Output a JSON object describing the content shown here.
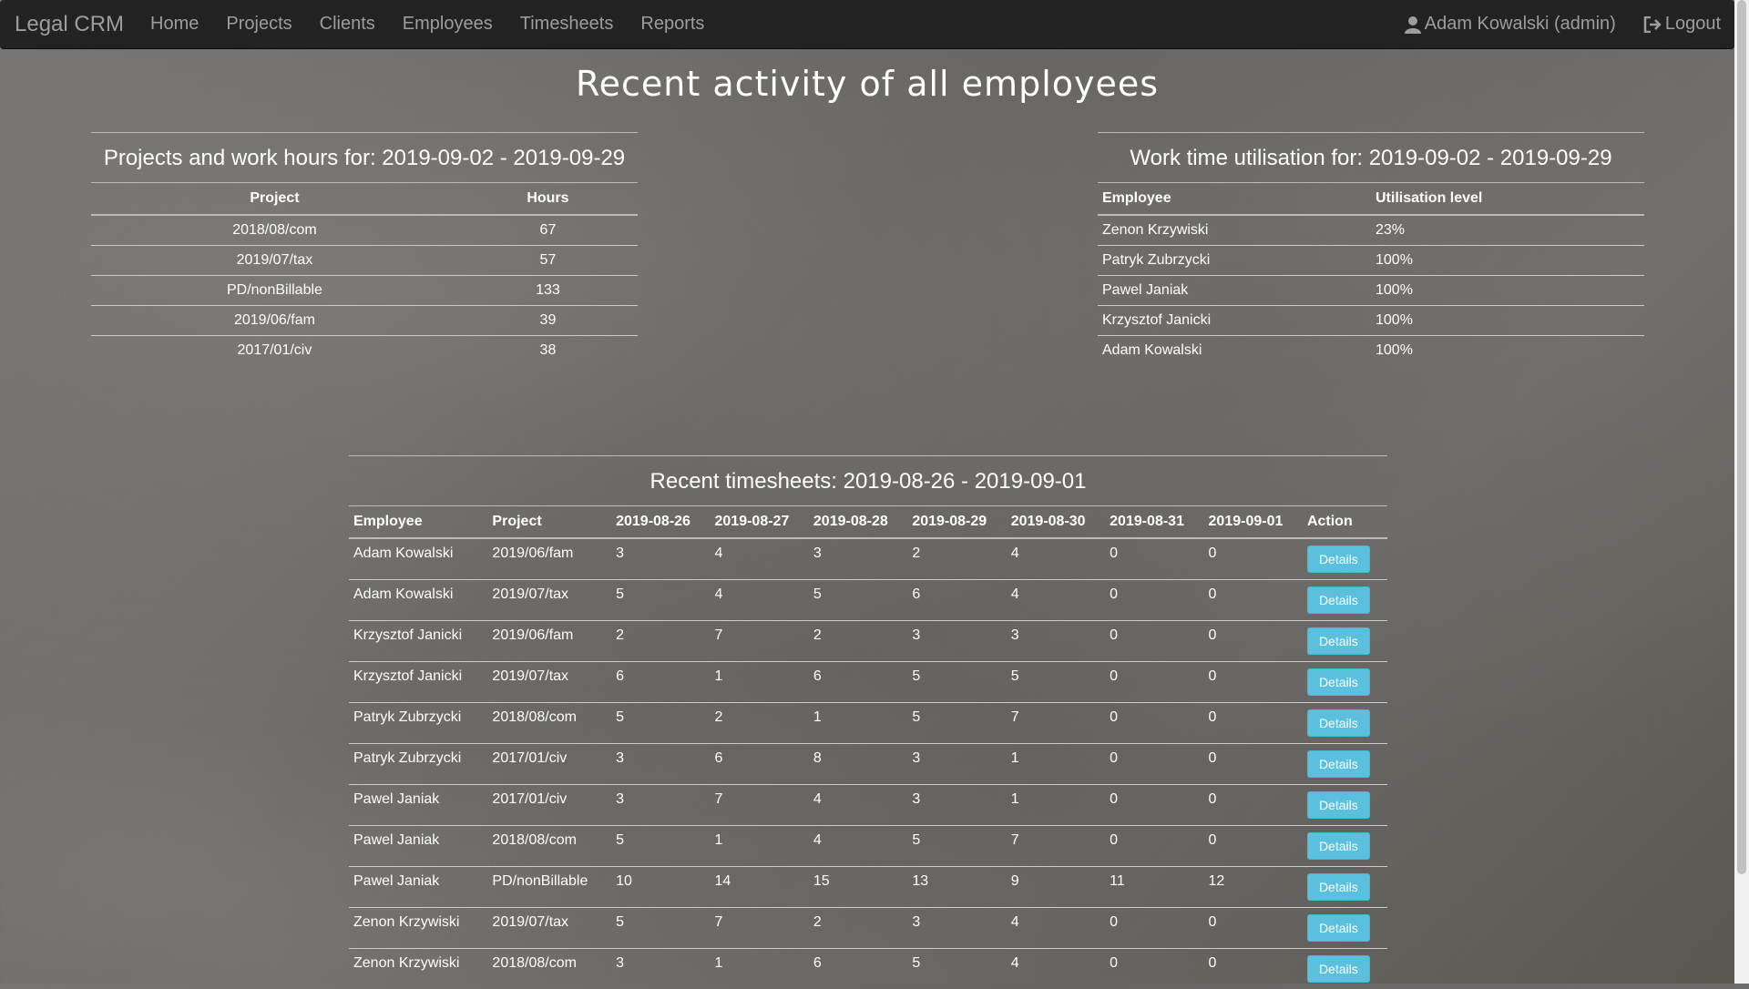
{
  "nav": {
    "brand": "Legal CRM",
    "links": [
      "Home",
      "Projects",
      "Clients",
      "Employees",
      "Timesheets",
      "Reports"
    ],
    "user": "Adam Kowalski (admin)",
    "logout": "Logout"
  },
  "page_title": "Recent activity of all employees",
  "projects": {
    "title": "Projects and work hours for: 2019-09-02 - 2019-09-29",
    "headers": [
      "Project",
      "Hours"
    ],
    "rows": [
      [
        "2018/08/com",
        "67"
      ],
      [
        "2019/07/tax",
        "57"
      ],
      [
        "PD/nonBillable",
        "133"
      ],
      [
        "2019/06/fam",
        "39"
      ],
      [
        "2017/01/civ",
        "38"
      ]
    ]
  },
  "utilisation": {
    "title": "Work time utilisation for: 2019-09-02 - 2019-09-29",
    "headers": [
      "Employee",
      "Utilisation level"
    ],
    "rows": [
      [
        "Zenon Krzywiski",
        "23%"
      ],
      [
        "Patryk Zubrzycki",
        "100%"
      ],
      [
        "Pawel Janiak",
        "100%"
      ],
      [
        "Krzysztof Janicki",
        "100%"
      ],
      [
        "Adam Kowalski",
        "100%"
      ]
    ]
  },
  "timesheets": {
    "title": "Recent timesheets: 2019-08-26 - 2019-09-01",
    "headers": [
      "Employee",
      "Project",
      "2019-08-26",
      "2019-08-27",
      "2019-08-28",
      "2019-08-29",
      "2019-08-30",
      "2019-08-31",
      "2019-09-01",
      "Action"
    ],
    "button_label": "Details",
    "rows": [
      [
        "Adam Kowalski",
        "2019/06/fam",
        "3",
        "4",
        "3",
        "2",
        "4",
        "0",
        "0"
      ],
      [
        "Adam Kowalski",
        "2019/07/tax",
        "5",
        "4",
        "5",
        "6",
        "4",
        "0",
        "0"
      ],
      [
        "Krzysztof Janicki",
        "2019/06/fam",
        "2",
        "7",
        "2",
        "3",
        "3",
        "0",
        "0"
      ],
      [
        "Krzysztof Janicki",
        "2019/07/tax",
        "6",
        "1",
        "6",
        "5",
        "5",
        "0",
        "0"
      ],
      [
        "Patryk Zubrzycki",
        "2018/08/com",
        "5",
        "2",
        "1",
        "5",
        "7",
        "0",
        "0"
      ],
      [
        "Patryk Zubrzycki",
        "2017/01/civ",
        "3",
        "6",
        "8",
        "3",
        "1",
        "0",
        "0"
      ],
      [
        "Pawel Janiak",
        "2017/01/civ",
        "3",
        "7",
        "4",
        "3",
        "1",
        "0",
        "0"
      ],
      [
        "Pawel Janiak",
        "2018/08/com",
        "5",
        "1",
        "4",
        "5",
        "7",
        "0",
        "0"
      ],
      [
        "Pawel Janiak",
        "PD/nonBillable",
        "10",
        "14",
        "15",
        "13",
        "9",
        "11",
        "12"
      ],
      [
        "Zenon Krzywiski",
        "2019/07/tax",
        "5",
        "7",
        "2",
        "3",
        "4",
        "0",
        "0"
      ],
      [
        "Zenon Krzywiski",
        "2018/08/com",
        "3",
        "1",
        "6",
        "5",
        "4",
        "0",
        "0"
      ]
    ]
  }
}
